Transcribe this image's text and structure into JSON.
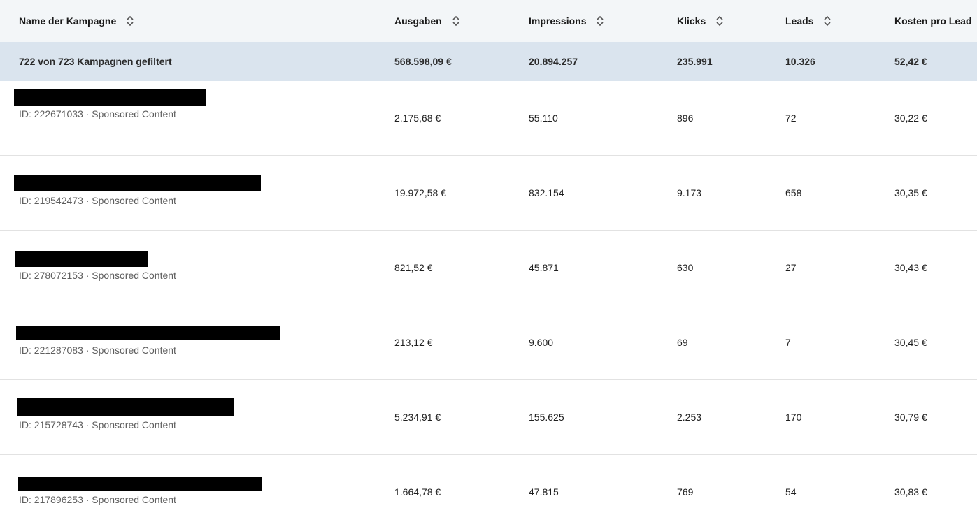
{
  "header": {
    "name": "Name der Kampagne",
    "spend": "Ausgaben",
    "impressions": "Impressions",
    "clicks": "Klicks",
    "leads": "Leads",
    "cpl": "Kosten pro Lead"
  },
  "summary": {
    "label": "722 von 723 Kampagnen gefiltert",
    "spend": "568.598,09 €",
    "impressions": "20.894.257",
    "clicks": "235.991",
    "leads": "10.326",
    "cpl": "52,42 €"
  },
  "rows": [
    {
      "meta": "ID: 222671033 · Sponsored Content",
      "spend": "2.175,68 €",
      "impressions": "55.110",
      "clicks": "896",
      "leads": "72",
      "cpl": "30,22 €"
    },
    {
      "meta": "ID: 219542473 · Sponsored Content",
      "spend": "19.972,58 €",
      "impressions": "832.154",
      "clicks": "9.173",
      "leads": "658",
      "cpl": "30,35 €"
    },
    {
      "meta": "ID: 278072153 · Sponsored Content",
      "spend": "821,52 €",
      "impressions": "45.871",
      "clicks": "630",
      "leads": "27",
      "cpl": "30,43 €"
    },
    {
      "meta": "ID: 221287083 · Sponsored Content",
      "spend": "213,12 €",
      "impressions": "9.600",
      "clicks": "69",
      "leads": "7",
      "cpl": "30,45 €"
    },
    {
      "meta": "ID: 215728743 · Sponsored Content",
      "spend": "5.234,91 €",
      "impressions": "155.625",
      "clicks": "2.253",
      "leads": "170",
      "cpl": "30,79 €"
    },
    {
      "meta": "ID: 217896253 · Sponsored Content",
      "spend": "1.664,78 €",
      "impressions": "47.815",
      "clicks": "769",
      "leads": "54",
      "cpl": "30,83 €"
    }
  ],
  "icons": {
    "sort": "sort-up-down-icon"
  },
  "colors": {
    "header_bg": "#f3f6f8",
    "summary_bg": "#dae4ee",
    "redaction": "#000000"
  }
}
